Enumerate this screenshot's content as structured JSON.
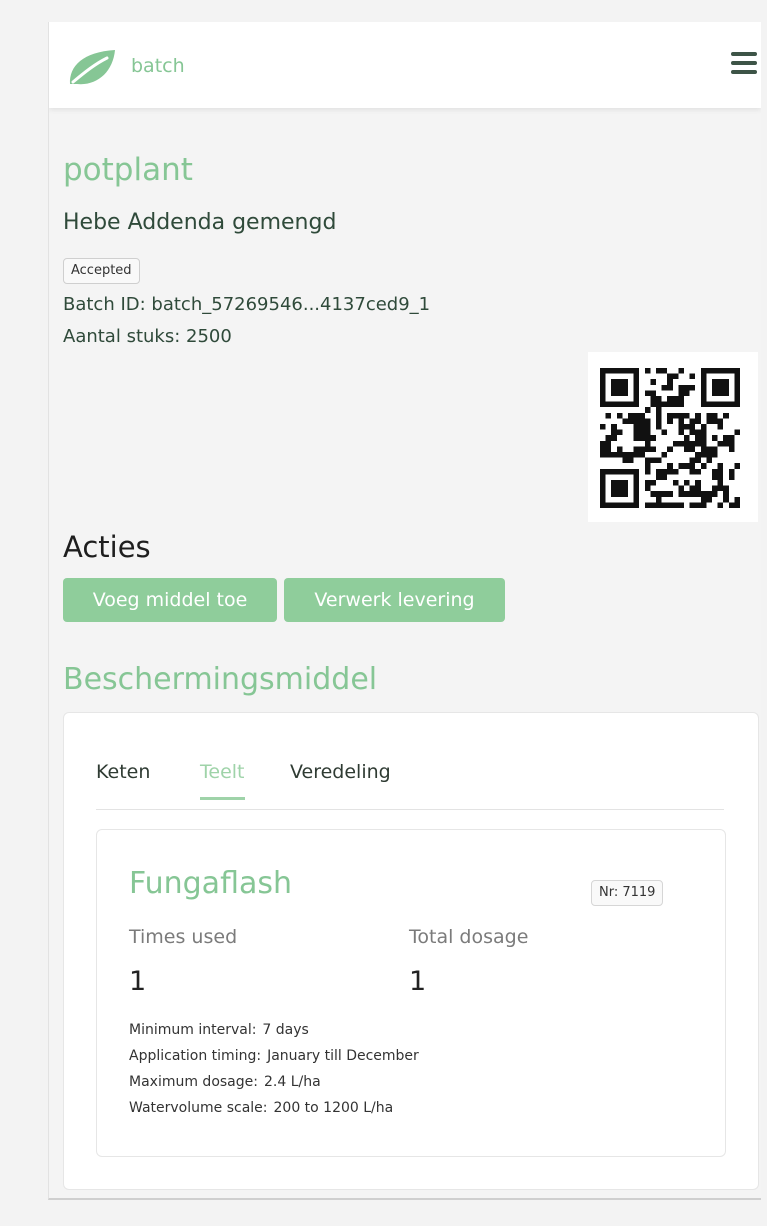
{
  "navbar": {
    "brand": "batch",
    "logo_icon": "leaf-icon",
    "menu_icon": "hamburger-menu-icon"
  },
  "header": {
    "category": "potplant",
    "plant_name": "Hebe Addenda gemengd",
    "status": "Accepted",
    "batch_id": "Batch ID: batch_57269546...4137ced9_1",
    "aantal": "Aantal stuks: 2500"
  },
  "acties": {
    "title": "Acties",
    "buttons": [
      "Voeg middel toe",
      "Verwerk levering"
    ]
  },
  "section": {
    "title": "Beschermingsmiddel",
    "tabs": [
      "Keten",
      "Teelt",
      "Veredeling"
    ],
    "active_tab": "Teelt"
  },
  "product": {
    "name": "Fungaflash",
    "nr": "Nr: 7119",
    "times_used_label": "Times used",
    "times_used": "1",
    "total_dosage_label": "Total dosage",
    "total_dosage": "1",
    "details": [
      {
        "label": "Minimum interval:",
        "value": "7 days"
      },
      {
        "label": "Application timing:",
        "value": "January till December"
      },
      {
        "label": "Maximum dosage:",
        "value": "2.4 L/ha"
      },
      {
        "label": "Watervolume scale:",
        "value": "200 to 1200 L/ha"
      }
    ]
  },
  "colors": {
    "accent": "#86c695",
    "button": "#8fcd9b",
    "text_dark": "#2f4a3a"
  }
}
